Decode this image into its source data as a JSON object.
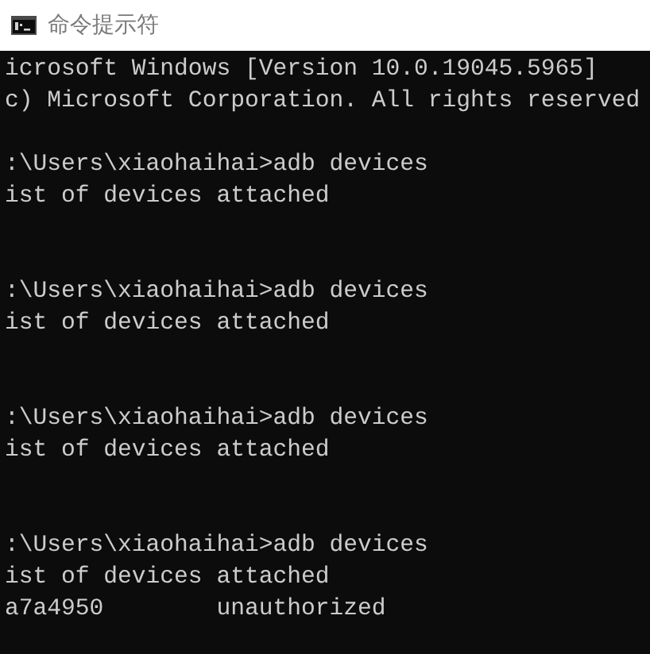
{
  "window": {
    "title": "命令提示符"
  },
  "console": {
    "blocks": [
      {
        "kind": "banner",
        "lines": [
          "icrosoft Windows [Version 10.0.19045.5965]",
          "c) Microsoft Corporation. All rights reserved"
        ]
      },
      {
        "kind": "command",
        "lines": [
          ":\\Users\\xiaohaihai>adb devices",
          "ist of devices attached"
        ]
      },
      {
        "kind": "command",
        "lines": [
          ":\\Users\\xiaohaihai>adb devices",
          "ist of devices attached"
        ]
      },
      {
        "kind": "command",
        "lines": [
          ":\\Users\\xiaohaihai>adb devices",
          "ist of devices attached"
        ]
      },
      {
        "kind": "command",
        "lines": [
          ":\\Users\\xiaohaihai>adb devices",
          "ist of devices attached",
          "a7a4950        unauthorized"
        ]
      }
    ]
  }
}
